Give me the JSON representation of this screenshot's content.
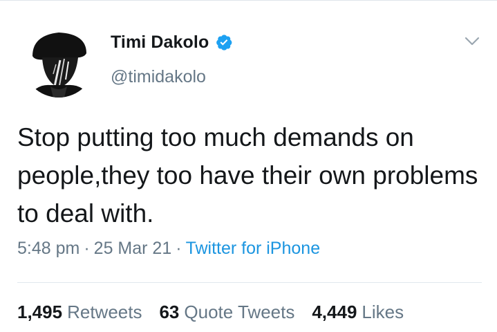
{
  "author": {
    "display_name": "Timi Dakolo",
    "handle": "@timidakolo",
    "verified_icon": "verified-badge-icon",
    "avatar": "avatar"
  },
  "tweet": {
    "text": "Stop putting too much demands on people,they too have their own problems to deal with."
  },
  "meta": {
    "time": "5:48 pm",
    "separator": "·",
    "date": "25 Mar 21",
    "source": "Twitter for iPhone"
  },
  "stats": {
    "retweets_count": "1,495",
    "retweets_label": "Retweets",
    "quotes_count": "63",
    "quotes_label": "Quote Tweets",
    "likes_count": "4,449",
    "likes_label": "Likes"
  },
  "menu": {
    "icon": "chevron-down-icon"
  },
  "colors": {
    "text": "#14171a",
    "secondary": "#657786",
    "link": "#1b95e0",
    "verified": "#1da1f2"
  }
}
